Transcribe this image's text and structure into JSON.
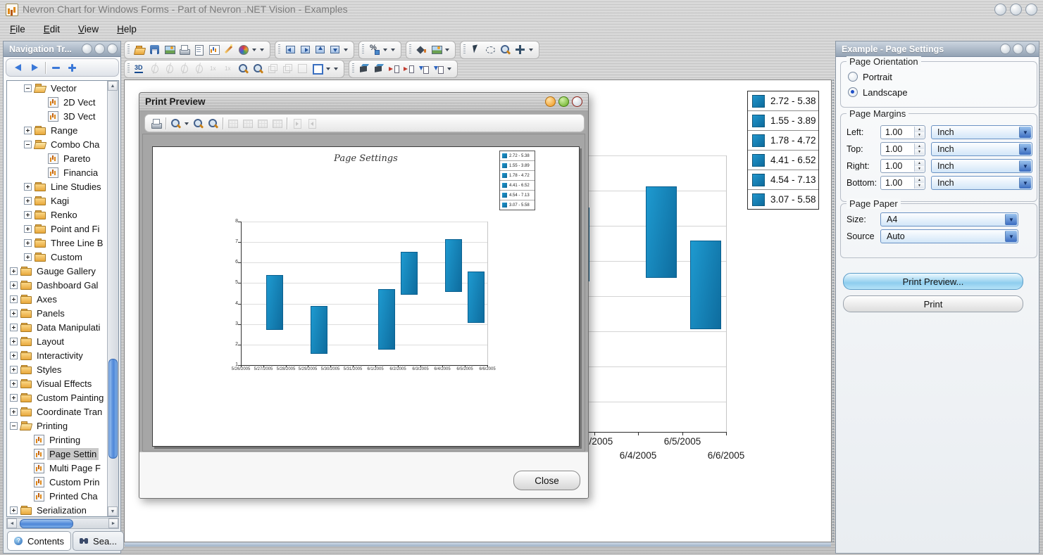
{
  "window": {
    "title": "Nevron Chart for Windows Forms - Part of Nevron .NET Vision - Examples",
    "menu": [
      "File",
      "Edit",
      "View",
      "Help"
    ],
    "window_buttons": [
      "minimize",
      "maximize",
      "close"
    ]
  },
  "toolbars": {
    "row1": [
      [
        {
          "icon": "folder-open"
        },
        {
          "icon": "save"
        },
        {
          "icon": "image"
        },
        {
          "icon": "print"
        },
        {
          "icon": "document"
        },
        {
          "icon": "chart-bars"
        },
        {
          "icon": "pen"
        },
        {
          "icon": "palette"
        },
        {
          "icon": "dd"
        },
        {
          "icon": "dd"
        }
      ],
      [
        {
          "icon": "dock-left"
        },
        {
          "icon": "dock-right"
        },
        {
          "icon": "dock-top"
        },
        {
          "icon": "dock-bottom"
        },
        {
          "icon": "dd"
        }
      ],
      [
        {
          "icon": "scale"
        },
        {
          "icon": "dd"
        },
        {
          "icon": "dd"
        }
      ],
      [
        {
          "icon": "bucket"
        },
        {
          "icon": "image"
        },
        {
          "icon": "dd"
        }
      ],
      [
        {
          "icon": "cursor"
        },
        {
          "icon": "lasso"
        },
        {
          "icon": "zoomtool"
        },
        {
          "icon": "move"
        },
        {
          "icon": "dd"
        }
      ]
    ],
    "row2": [
      [
        {
          "icon": "threed"
        },
        {
          "icon": "rotate-a",
          "disabled": true
        },
        {
          "icon": "rotate-b",
          "disabled": true
        },
        {
          "icon": "rotate-c",
          "disabled": true
        },
        {
          "icon": "rotate-d",
          "disabled": true
        },
        {
          "icon": "fx-up",
          "disabled": true
        },
        {
          "icon": "fx-down",
          "disabled": true
        },
        {
          "icon": "zoom-in"
        },
        {
          "icon": "zoom-out"
        },
        {
          "icon": "cube",
          "disabled": true
        },
        {
          "icon": "cube2",
          "disabled": true
        },
        {
          "icon": "frame",
          "disabled": true
        },
        {
          "icon": "frame-blue"
        },
        {
          "icon": "dd"
        },
        {
          "icon": "dd"
        }
      ],
      [
        {
          "icon": "wall"
        },
        {
          "icon": "wall2"
        },
        {
          "icon": "gap-h1"
        },
        {
          "icon": "gap-h2"
        },
        {
          "icon": "gap-v1"
        },
        {
          "icon": "gap-v2"
        },
        {
          "icon": "dd"
        }
      ]
    ]
  },
  "nav_panel": {
    "title": "Navigation Tr...",
    "toolbar": [
      "arrow-left",
      "arrow-right",
      "sep",
      "minus",
      "plus"
    ],
    "tree": [
      {
        "lvl": 1,
        "exp": "minus",
        "icon": "folder-open",
        "label": "Vector"
      },
      {
        "lvl": 2,
        "exp": "none",
        "icon": "chart",
        "label": "2D Vect"
      },
      {
        "lvl": 2,
        "exp": "none",
        "icon": "chart",
        "label": "3D Vect"
      },
      {
        "lvl": 1,
        "exp": "plus",
        "icon": "folder",
        "label": "Range"
      },
      {
        "lvl": 1,
        "exp": "minus",
        "icon": "folder-open",
        "label": "Combo Cha"
      },
      {
        "lvl": 2,
        "exp": "none",
        "icon": "chart",
        "label": "Pareto"
      },
      {
        "lvl": 2,
        "exp": "none",
        "icon": "chart",
        "label": "Financia"
      },
      {
        "lvl": 1,
        "exp": "plus",
        "icon": "folder",
        "label": "Line Studies"
      },
      {
        "lvl": 1,
        "exp": "plus",
        "icon": "folder",
        "label": "Kagi"
      },
      {
        "lvl": 1,
        "exp": "plus",
        "icon": "folder",
        "label": "Renko"
      },
      {
        "lvl": 1,
        "exp": "plus",
        "icon": "folder",
        "label": "Point and Fi"
      },
      {
        "lvl": 1,
        "exp": "plus",
        "icon": "folder",
        "label": "Three Line B"
      },
      {
        "lvl": 1,
        "exp": "plus",
        "icon": "folder",
        "label": "Custom"
      },
      {
        "lvl": 0,
        "exp": "plus",
        "icon": "folder",
        "label": "Gauge Gallery"
      },
      {
        "lvl": 0,
        "exp": "plus",
        "icon": "folder",
        "label": "Dashboard Gal"
      },
      {
        "lvl": 0,
        "exp": "plus",
        "icon": "folder",
        "label": "Axes"
      },
      {
        "lvl": 0,
        "exp": "plus",
        "icon": "folder",
        "label": "Panels"
      },
      {
        "lvl": 0,
        "exp": "plus",
        "icon": "folder",
        "label": "Data Manipulati"
      },
      {
        "lvl": 0,
        "exp": "plus",
        "icon": "folder",
        "label": "Layout"
      },
      {
        "lvl": 0,
        "exp": "plus",
        "icon": "folder",
        "label": "Interactivity"
      },
      {
        "lvl": 0,
        "exp": "plus",
        "icon": "folder",
        "label": "Styles"
      },
      {
        "lvl": 0,
        "exp": "plus",
        "icon": "folder",
        "label": "Visual Effects"
      },
      {
        "lvl": 0,
        "exp": "plus",
        "icon": "folder",
        "label": "Custom Painting"
      },
      {
        "lvl": 0,
        "exp": "plus",
        "icon": "folder",
        "label": "Coordinate Tran"
      },
      {
        "lvl": 0,
        "exp": "minus",
        "icon": "folder-open",
        "label": "Printing"
      },
      {
        "lvl": 1,
        "exp": "none",
        "icon": "chart",
        "label": "Printing"
      },
      {
        "lvl": 1,
        "exp": "none",
        "icon": "chart",
        "label": "Page Settin",
        "selected": true
      },
      {
        "lvl": 1,
        "exp": "none",
        "icon": "chart",
        "label": "Multi Page F"
      },
      {
        "lvl": 1,
        "exp": "none",
        "icon": "chart",
        "label": "Custom Prin"
      },
      {
        "lvl": 1,
        "exp": "none",
        "icon": "chart",
        "label": "Printed Cha"
      },
      {
        "lvl": 0,
        "exp": "plus",
        "icon": "folder",
        "label": "Serialization"
      }
    ],
    "tabs": [
      {
        "icon": "contents",
        "label": "Contents"
      },
      {
        "icon": "search",
        "label": "Sea..."
      }
    ]
  },
  "chart_data": {
    "type": "bar",
    "subtype": "floating-range-bars",
    "title": "Page Settings",
    "x_categories": [
      "5/26/2005",
      "5/27/2005",
      "5/28/2005",
      "5/29/2005",
      "5/30/2005",
      "5/31/2005",
      "6/1/2005",
      "6/2/2005",
      "6/3/2005",
      "6/4/2005",
      "6/5/2005",
      "6/6/2005"
    ],
    "ylim": [
      1,
      8
    ],
    "yticks": [
      1,
      2,
      3,
      4,
      5,
      6,
      7,
      8
    ],
    "grid": true,
    "legend_position": "top-right",
    "bars": [
      {
        "label": "2.72 - 5.38",
        "day_index": 1,
        "low": 2.72,
        "high": 5.38
      },
      {
        "label": "1.55 - 3.89",
        "day_index": 3,
        "low": 1.55,
        "high": 3.89
      },
      {
        "label": "1.78 - 4.72",
        "day_index": 6,
        "low": 1.78,
        "high": 4.72
      },
      {
        "label": "4.41 - 6.52",
        "day_index": 7,
        "low": 4.41,
        "high": 6.52
      },
      {
        "label": "4.54 - 7.13",
        "day_index": 9,
        "low": 4.54,
        "high": 7.13
      },
      {
        "label": "3.07 - 5.58",
        "day_index": 10,
        "low": 3.07,
        "high": 5.58
      }
    ]
  },
  "print_preview_dialog": {
    "title": "Print Preview",
    "toolbar": [
      {
        "icon": "printer"
      },
      {
        "icon": "sep"
      },
      {
        "icon": "zoomtool"
      },
      {
        "icon": "dd"
      },
      {
        "icon": "zoom-in"
      },
      {
        "icon": "zoom-out"
      },
      {
        "icon": "sep"
      },
      {
        "icon": "pages-1",
        "disabled": true
      },
      {
        "icon": "pages-2",
        "disabled": true
      },
      {
        "icon": "pages-3",
        "disabled": true
      },
      {
        "icon": "pages-4",
        "disabled": true
      },
      {
        "icon": "sep"
      },
      {
        "icon": "page-next",
        "disabled": true
      },
      {
        "icon": "page-prev",
        "disabled": true
      }
    ],
    "close_button": "Close"
  },
  "settings_panel": {
    "title": "Example - Page Settings",
    "orientation": {
      "label": "Page Orientation",
      "options": [
        {
          "label": "Portrait",
          "selected": false
        },
        {
          "label": "Landscape",
          "selected": true
        }
      ]
    },
    "margins": {
      "label": "Page Margins",
      "rows": [
        {
          "label": "Left:",
          "value": "1.00",
          "unit": "Inch"
        },
        {
          "label": "Top:",
          "value": "1.00",
          "unit": "Inch"
        },
        {
          "label": "Right:",
          "value": "1.00",
          "unit": "Inch"
        },
        {
          "label": "Bottom:",
          "value": "1.00",
          "unit": "Inch"
        }
      ]
    },
    "paper": {
      "label": "Page Paper",
      "rows": [
        {
          "label": "Size:",
          "value": "A4"
        },
        {
          "label": "Source",
          "value": "Auto"
        }
      ]
    },
    "buttons": [
      {
        "label": "Print Preview...",
        "style": "primary"
      },
      {
        "label": "Print",
        "style": "default"
      }
    ]
  },
  "colors": {
    "bar_light": "#1e9ad0",
    "bar_dark": "#0e6c9e",
    "legend_swatch": "#1383b8"
  }
}
